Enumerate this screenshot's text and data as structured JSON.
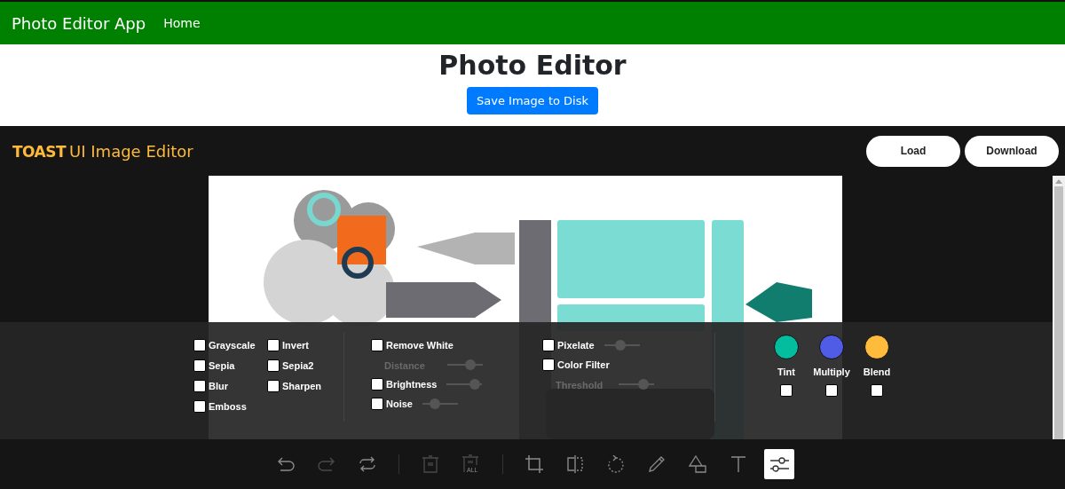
{
  "navbar": {
    "brand": "Photo Editor App",
    "links": [
      {
        "label": "Home"
      }
    ]
  },
  "header": {
    "title": "Photo Editor",
    "button": "Save Image to Disk"
  },
  "editor": {
    "logo_mark": "TOAST",
    "logo_text": "UI Image Editor",
    "buttons": [
      "Load",
      "Download"
    ],
    "canvas": {
      "kind": "picture"
    },
    "filter_groups": [
      {
        "items": [
          {
            "kind": "check",
            "label": "Grayscale",
            "checked": false
          },
          {
            "kind": "check",
            "label": "Sepia",
            "checked": false
          },
          {
            "kind": "check",
            "label": "Blur",
            "checked": false
          },
          {
            "kind": "check",
            "label": "Emboss",
            "checked": false
          }
        ]
      },
      {
        "items": [
          {
            "kind": "check",
            "label": "Invert",
            "checked": false
          },
          {
            "kind": "check",
            "label": "Sepia2",
            "checked": false
          },
          {
            "kind": "check",
            "label": "Sharpen",
            "checked": false
          }
        ]
      },
      {
        "items": [
          {
            "kind": "check",
            "label": "Remove White",
            "checked": false
          },
          {
            "kind": "slider",
            "label": "Distance",
            "disabled": true,
            "level": 0.65
          },
          {
            "kind": "check-slider",
            "label": "Brightness",
            "checked": false,
            "level": 0.8
          },
          {
            "kind": "check-slider",
            "label": "Noise",
            "checked": false,
            "level": 0.35
          }
        ]
      },
      {
        "items": [
          {
            "kind": "check-slider",
            "label": "Pixelate",
            "checked": false,
            "level": 0.45
          },
          {
            "kind": "check",
            "label": "Color Filter",
            "checked": false
          },
          {
            "kind": "slider",
            "label": "Threshold",
            "disabled": true,
            "level": 0.7
          }
        ]
      }
    ],
    "color_filters": [
      {
        "label": "Tint",
        "color": "#03bd9e",
        "checked": false
      },
      {
        "label": "Multiply",
        "color": "#515ce6",
        "checked": false
      },
      {
        "label": "Blend",
        "color": "#ffbb3b",
        "checked": false
      }
    ],
    "toolbar": [
      {
        "kind": "undo",
        "disabled": false,
        "selected": false
      },
      {
        "kind": "redo",
        "disabled": true,
        "selected": false
      },
      {
        "kind": "reset",
        "disabled": false,
        "selected": false
      },
      {
        "kind": "separator"
      },
      {
        "kind": "delete",
        "disabled": true,
        "selected": false
      },
      {
        "kind": "delete-all",
        "label": "ALL",
        "disabled": true,
        "selected": false
      },
      {
        "kind": "separator"
      },
      {
        "kind": "crop",
        "disabled": false,
        "selected": false
      },
      {
        "kind": "flip",
        "disabled": false,
        "selected": false
      },
      {
        "kind": "rotate",
        "disabled": false,
        "selected": false
      },
      {
        "kind": "draw",
        "disabled": false,
        "selected": false
      },
      {
        "kind": "shape",
        "disabled": false,
        "selected": false
      },
      {
        "kind": "text",
        "disabled": false,
        "selected": false
      },
      {
        "kind": "filter",
        "disabled": false,
        "selected": true
      }
    ]
  }
}
